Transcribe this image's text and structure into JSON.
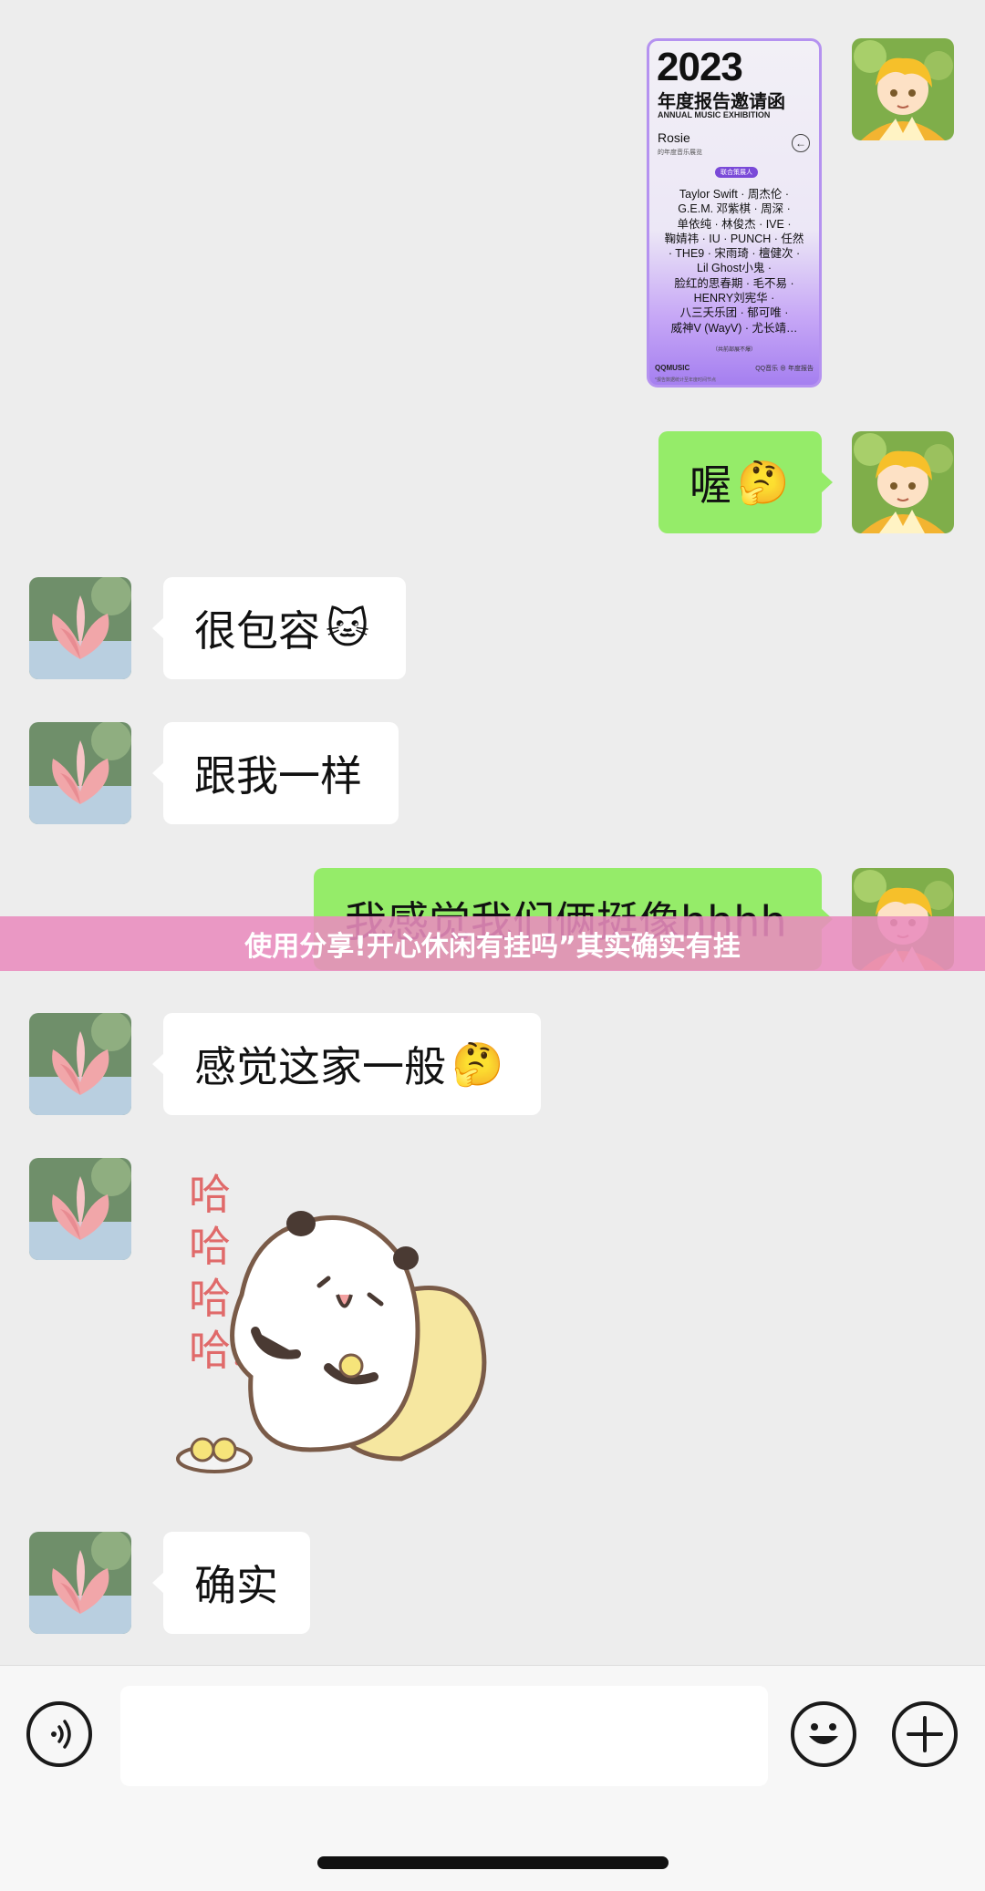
{
  "messages": [
    {
      "id": "m1",
      "side": "me",
      "type": "card"
    },
    {
      "id": "m2",
      "side": "me",
      "text": "喔",
      "emoji": "🤔"
    },
    {
      "id": "m3",
      "side": "them",
      "text": "很包容",
      "emoji": "🐱"
    },
    {
      "id": "m4",
      "side": "them",
      "text": "跟我一样"
    },
    {
      "id": "m5",
      "side": "me",
      "text": "我感觉我们俩挺像hhhh"
    },
    {
      "id": "m6",
      "side": "them",
      "text": "感觉这家一般",
      "emoji": "🤔"
    },
    {
      "id": "m7",
      "side": "them",
      "type": "sticker",
      "sticker_text": "哈哈哈哈…"
    },
    {
      "id": "m8",
      "side": "them",
      "text": "确实"
    }
  ],
  "card": {
    "year": "2023",
    "title": "年度报告邀请函",
    "subtitle": "ANNUAL MUSIC EXHIBITION",
    "name": "Rosie",
    "caption": "的年度音乐展览",
    "badge": "联合策展人",
    "artist_lines": [
      "Taylor Swift · 周杰伦 ·",
      "G.E.M. 邓紫棋 · 周深 ·",
      "单依纯 · 林俊杰 · IVE ·",
      "鞠婧祎 · IU · PUNCH · 任然",
      "· THE9 · 宋雨琦 · 檀健次 ·",
      "Lil Ghost小鬼 ·",
      "脸红的思春期 · 毛不易 ·",
      "HENRY刘宪华 ·",
      "八三夭乐团 · 郁可唯 ·",
      "威神V (WayV) · 尤长靖…"
    ],
    "small_note": "（共前部展不爆）",
    "footer_brand": "QQMUSIC",
    "footer_right": "QQ音乐 ⊕ 年度报告",
    "tiny_note": "*报告数据统计至年度时间节点"
  },
  "banner": {
    "text": "使用分享!开心休闲有挂吗”其实确实有挂"
  },
  "input_bar": {
    "value": "",
    "voice_icon": "voice-icon",
    "emoji_icon": "emoji-icon",
    "plus_icon": "plus-icon"
  },
  "colors": {
    "background": "#ededed",
    "my_bubble": "#95ec69",
    "their_bubble": "#ffffff",
    "banner": "#e98cbe"
  }
}
